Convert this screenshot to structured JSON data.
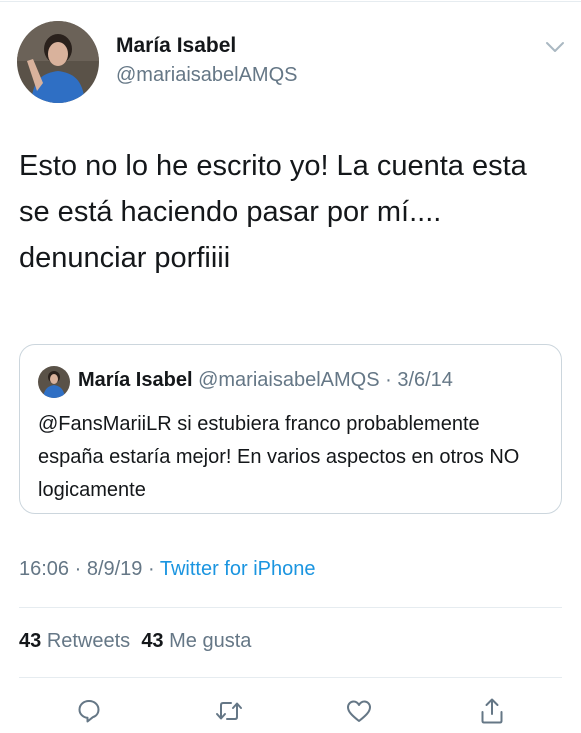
{
  "tweet": {
    "author": {
      "name": "María Isabel",
      "handle": "@mariaisabelAMQS",
      "avatar_icon": "avatar-photo"
    },
    "menu_icon": "chevron-down-icon",
    "text": "Esto no lo he escrito yo! La cuenta esta se está haciendo pasar por mí.... denunciar porfiiii",
    "quoted": {
      "author_name": "María Isabel",
      "handle_and_date": "@mariaisabelAMQS · 3/6/14",
      "text": "@FansMariiLR si estubiera franco probablemente españa estaría mejor! En varios aspectos en otros NO logicamente"
    },
    "timestamp": "16:06 · 8/9/19 · ",
    "source": "Twitter for iPhone",
    "stats": {
      "retweets_count": "43",
      "retweets_label": "Retweets",
      "likes_count": "43",
      "likes_label": "Me gusta"
    },
    "actions": [
      "reply-icon",
      "retweet-icon",
      "like-icon",
      "share-icon"
    ]
  },
  "colors": {
    "text_primary": "#14171a",
    "text_secondary": "#657786",
    "link": "#1b95e0",
    "border": "#ccd6dd",
    "divider": "#e6ecf0",
    "icon": "#657786"
  }
}
